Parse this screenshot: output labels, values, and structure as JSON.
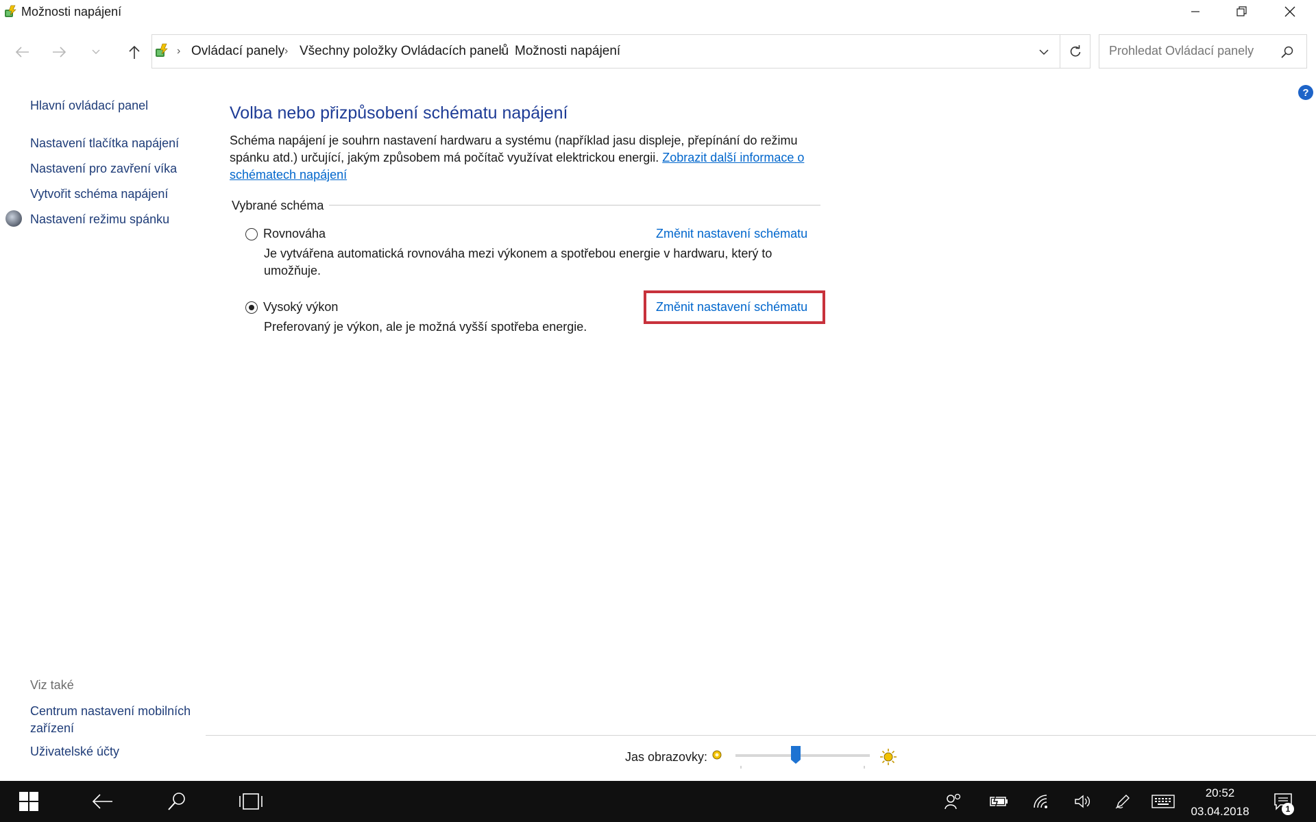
{
  "window": {
    "title": "Možnosti napájení"
  },
  "address_bar": {
    "breadcrumbs": [
      "Ovládací panely",
      "Všechny položky Ovládacích panelů",
      "Možnosti napájení"
    ]
  },
  "search": {
    "placeholder": "Prohledat Ovládací panely"
  },
  "sidebar": {
    "home": "Hlavní ovládací panel",
    "links": [
      "Nastavení tlačítka napájení",
      "Nastavení pro zavření víka",
      "Vytvořit schéma napájení",
      "Nastavení režimu spánku"
    ],
    "see_also_heading": "Viz také",
    "see_also_links": [
      "Centrum nastavení mobilních zařízení",
      "Uživatelské účty"
    ]
  },
  "main": {
    "title": "Volba nebo přizpůsobení schématu napájení",
    "description": "Schéma napájení je souhrn nastavení hardwaru a systému (například jasu displeje, přepínání do režimu spánku atd.) určující, jakým způsobem má počítač využívat elektrickou energii. ",
    "more_info_link": "Zobrazit další informace o schématech napájení",
    "group_label": "Vybrané schéma",
    "plans": [
      {
        "name": "Rovnováha",
        "description": "Je vytvářena automatická rovnováha mezi výkonem a spotřebou energie v hardwaru, který to umožňuje.",
        "change_link": "Změnit nastavení schématu",
        "selected": false
      },
      {
        "name": "Vysoký výkon",
        "description": "Preferovaný je výkon, ale je možná vyšší spotřeba energie.",
        "change_link": "Změnit nastavení schématu",
        "selected": true
      }
    ]
  },
  "brightness": {
    "label": "Jas obrazovky:",
    "level_fraction": 0.45
  },
  "taskbar": {
    "time": "20:52",
    "date": "03.04.2018",
    "notification_count": "1"
  },
  "colors": {
    "accent_link": "#0066cc",
    "title_blue": "#1e3c96",
    "highlight_red": "#c8323c",
    "taskbar": "#101010"
  }
}
